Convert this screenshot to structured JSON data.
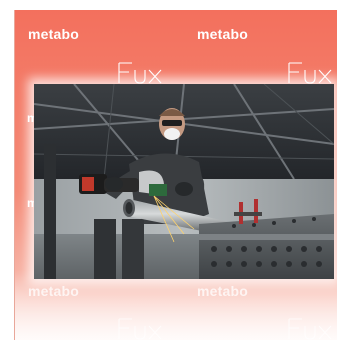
{
  "brand": {
    "logo_text": "metabo",
    "product_mark_text": "Fux",
    "background_color": "#f3705d"
  },
  "photo": {
    "subject": "worker cutting steel pipe with cordless angle grinder on perforated welding table"
  }
}
